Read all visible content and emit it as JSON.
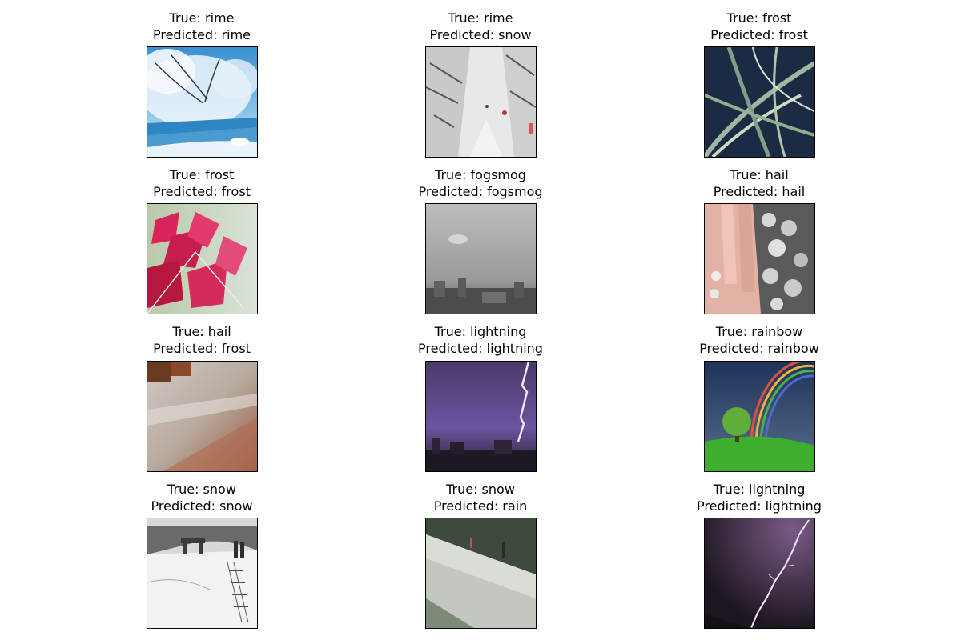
{
  "samples": [
    {
      "true_label": "True: rime",
      "pred_label": "Predicted: rime",
      "image": "rime-tree-icon"
    },
    {
      "true_label": "True: rime",
      "pred_label": "Predicted: snow",
      "image": "snowy-pine-path-icon"
    },
    {
      "true_label": "True: frost",
      "pred_label": "Predicted: frost",
      "image": "frosted-grass-icon"
    },
    {
      "true_label": "True: frost",
      "pred_label": "Predicted: frost",
      "image": "frosted-red-leaves-icon"
    },
    {
      "true_label": "True: fogsmog",
      "pred_label": "Predicted: fogsmog",
      "image": "smoggy-city-icon"
    },
    {
      "true_label": "True: hail",
      "pred_label": "Predicted: hail",
      "image": "hail-in-hand-icon"
    },
    {
      "true_label": "True: hail",
      "pred_label": "Predicted: frost",
      "image": "hail-on-ground-icon"
    },
    {
      "true_label": "True: lightning",
      "pred_label": "Predicted: lightning",
      "image": "city-lightning-icon"
    },
    {
      "true_label": "True: rainbow",
      "pred_label": "Predicted: rainbow",
      "image": "rainbow-tree-icon"
    },
    {
      "true_label": "True: snow",
      "pred_label": "Predicted: snow",
      "image": "snowy-hill-shelter-icon"
    },
    {
      "true_label": "True: snow",
      "pred_label": "Predicted: rain",
      "image": "snowy-slope-icon"
    },
    {
      "true_label": "True: lightning",
      "pred_label": "Predicted: lightning",
      "image": "purple-lightning-icon"
    }
  ]
}
